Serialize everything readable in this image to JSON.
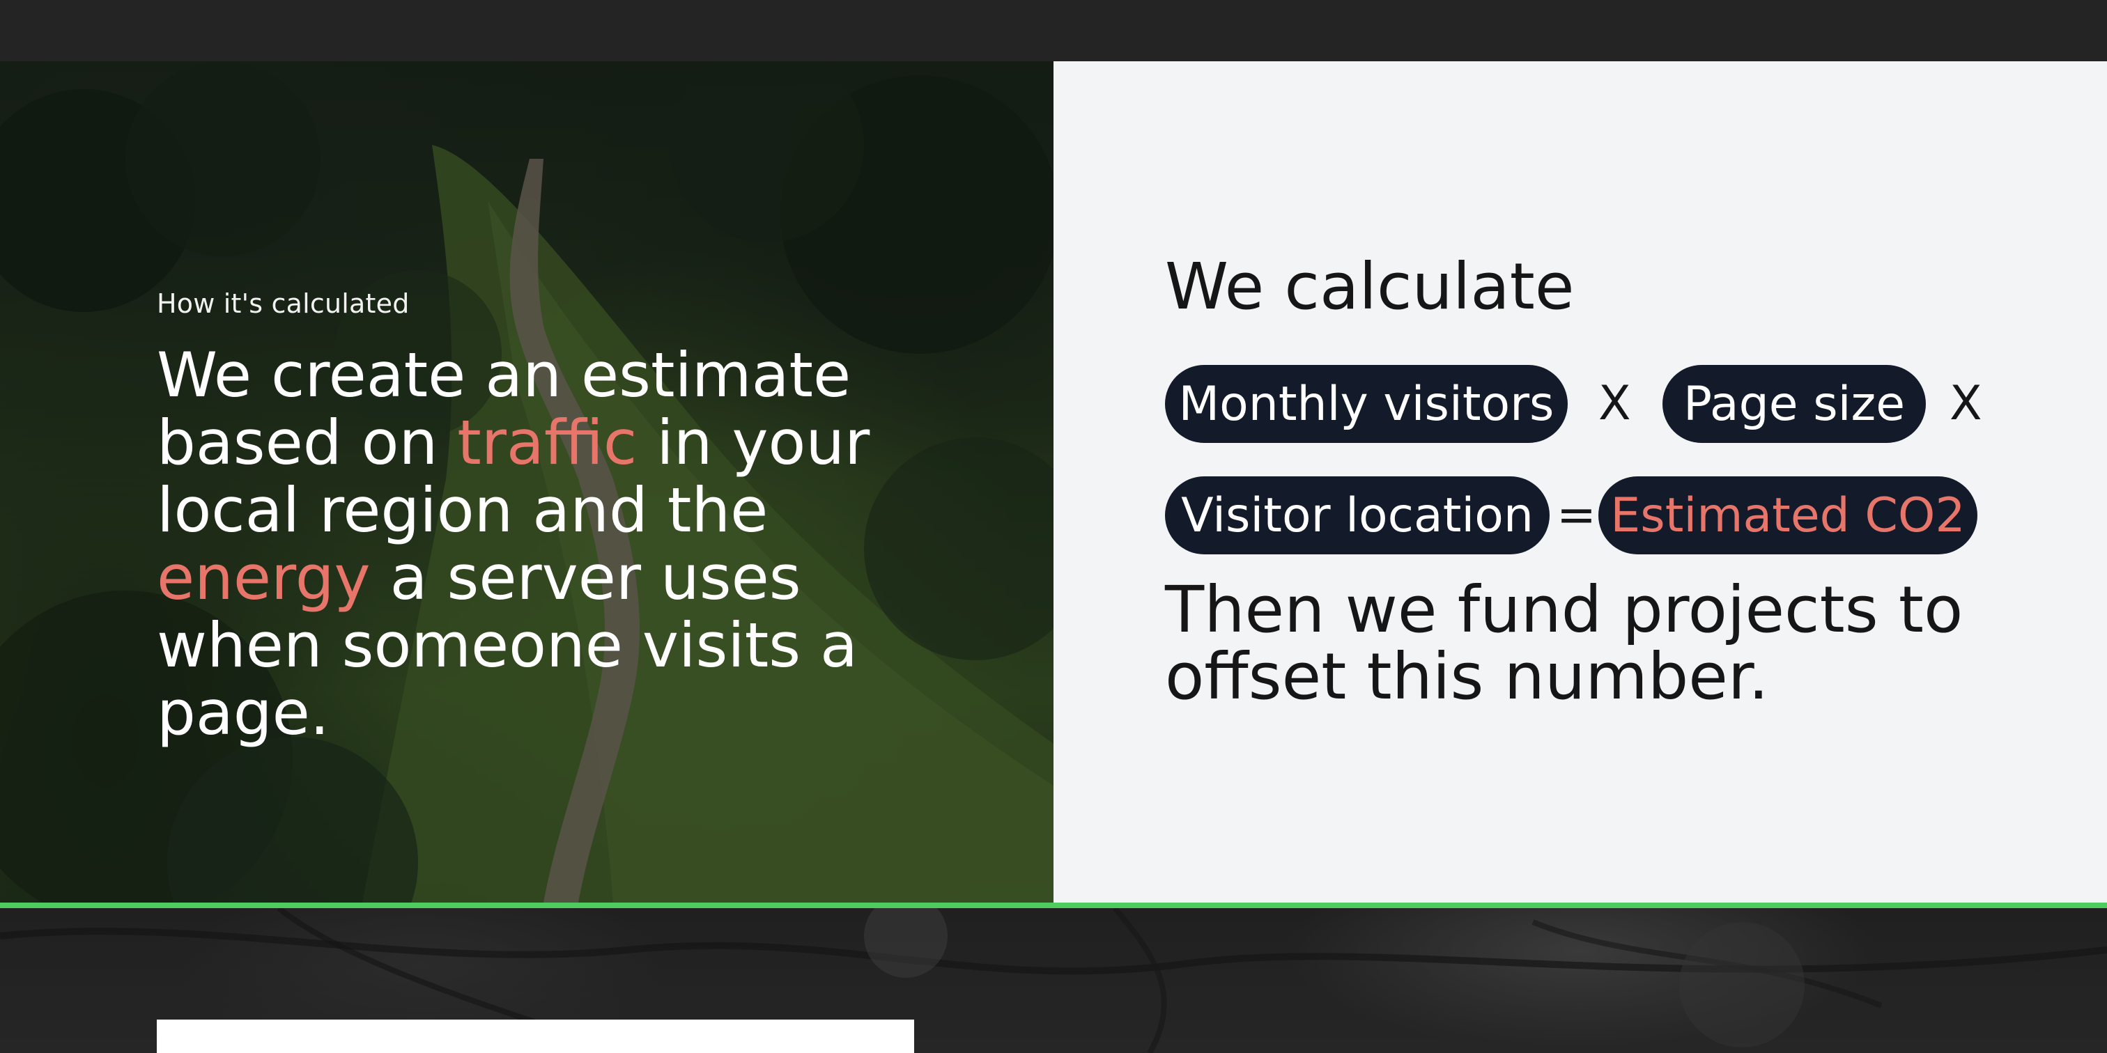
{
  "hero": {
    "eyebrow": "How it's calculated",
    "text_parts": {
      "p1": "We create an estimate based on ",
      "accent1": "traffic",
      "p2": " in your local region and the ",
      "accent2": "energy",
      "p3": " a server uses when someone visits a page."
    },
    "background_image": "aerial-forest-ridge-path"
  },
  "calculation": {
    "title": "We calculate",
    "terms": {
      "monthly_visitors": "Monthly visitors",
      "page_size": "Page size",
      "visitor_location": "Visitor location",
      "result": "Estimated CO2"
    },
    "operators": {
      "multiply1": "X",
      "multiply2": "X",
      "equals": "="
    },
    "footer": "Then we fund projects to offset this number."
  },
  "colors": {
    "accent": "#e8756a",
    "pill_bg": "#131a2a",
    "panel_bg": "#f3f4f6",
    "divider": "#4ecc5f",
    "topbar": "#242424"
  }
}
